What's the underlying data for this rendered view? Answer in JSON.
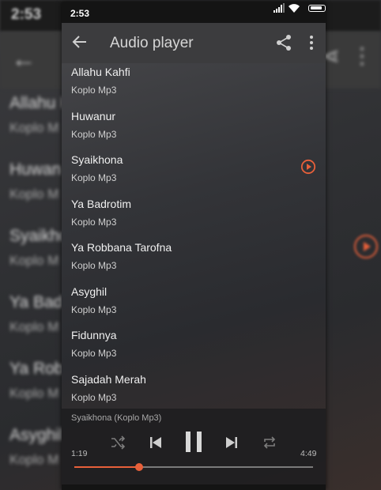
{
  "background": {
    "time": "2:53",
    "visible_titles": [
      "Allahu K",
      "Huwan",
      "Syaikho",
      "Ya Bad",
      "Ya Robb",
      "Asyghil"
    ],
    "visible_sub": "Koplo M"
  },
  "status_bar": {
    "time": "2:53"
  },
  "app_bar": {
    "title": "Audio player",
    "back_icon": "arrow-back-icon",
    "share_icon": "share-icon",
    "more_icon": "more-vert-icon"
  },
  "tracks": [
    {
      "title": "Allahu Kahfi",
      "subtitle": "Koplo Mp3"
    },
    {
      "title": "Huwanur",
      "subtitle": "Koplo Mp3"
    },
    {
      "title": "Syaikhona",
      "subtitle": "Koplo Mp3",
      "playing": true
    },
    {
      "title": "Ya Badrotim",
      "subtitle": "Koplo Mp3"
    },
    {
      "title": "Ya Robbana Tarofna",
      "subtitle": "Koplo Mp3"
    },
    {
      "title": "Asyghil",
      "subtitle": "Koplo Mp3"
    },
    {
      "title": "Fidunnya",
      "subtitle": "Koplo Mp3"
    },
    {
      "title": "Sajadah Merah",
      "subtitle": "Koplo Mp3"
    }
  ],
  "player": {
    "now_playing": "Syaikhona (Koplo Mp3)",
    "elapsed": "1:19",
    "total": "4:49",
    "progress": 0.27
  },
  "colors": {
    "accent": "#e8603a",
    "appbar": "#3c3c3e",
    "status": "#141414"
  }
}
